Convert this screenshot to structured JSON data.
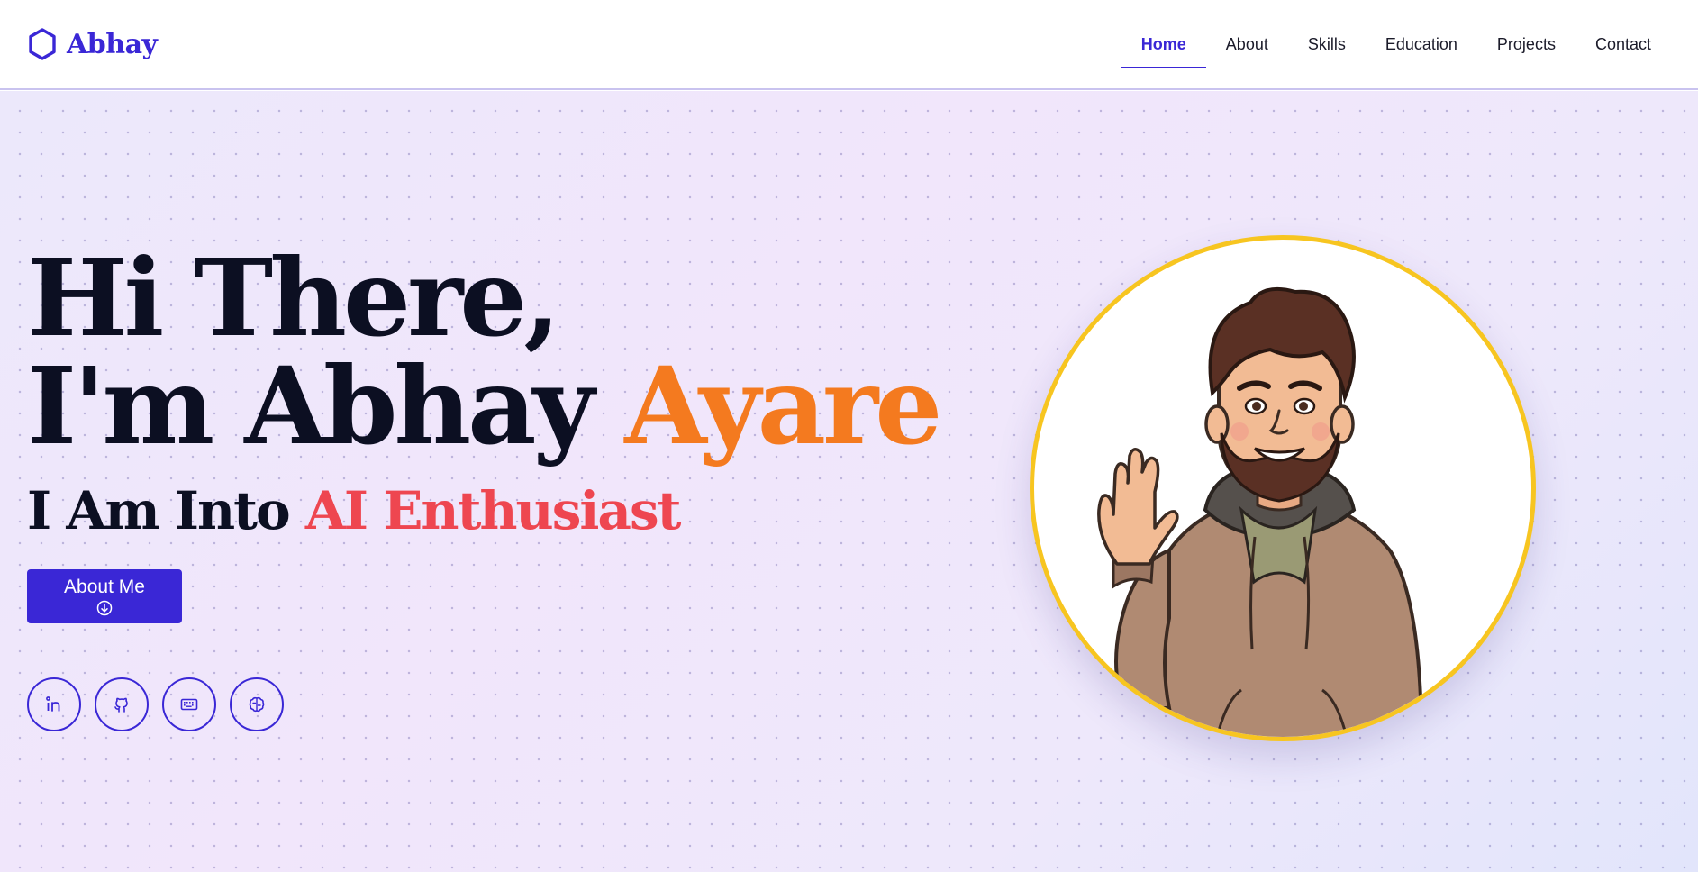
{
  "brand": {
    "name": "Abhay",
    "icon": "hexagon-icon",
    "color": "#3a27d6"
  },
  "nav": {
    "items": [
      {
        "label": "Home",
        "active": true
      },
      {
        "label": "About",
        "active": false
      },
      {
        "label": "Skills",
        "active": false
      },
      {
        "label": "Education",
        "active": false
      },
      {
        "label": "Projects",
        "active": false
      },
      {
        "label": "Contact",
        "active": false
      }
    ]
  },
  "hero": {
    "greeting": "Hi There,",
    "intro": "I'm Abhay",
    "surname": "Ayare",
    "tagline_prefix": "I Am Into",
    "tagline_typed": "AI Enthusiast",
    "button_label": "About Me",
    "button_icon": "arrow-down-circle-icon",
    "socials": [
      {
        "name": "linkedin",
        "icon": "linkedin-icon"
      },
      {
        "name": "github",
        "icon": "github-icon"
      },
      {
        "name": "keyboard",
        "icon": "keyboard-icon"
      },
      {
        "name": "brain",
        "icon": "brain-icon"
      }
    ],
    "avatar": "cartoon-waving-man-avatar"
  },
  "colors": {
    "primary": "#3a27d6",
    "surname": "#f47a1f",
    "typed": "#ee4650",
    "avatar_border": "#f7c520",
    "text": "#0c0f22"
  }
}
